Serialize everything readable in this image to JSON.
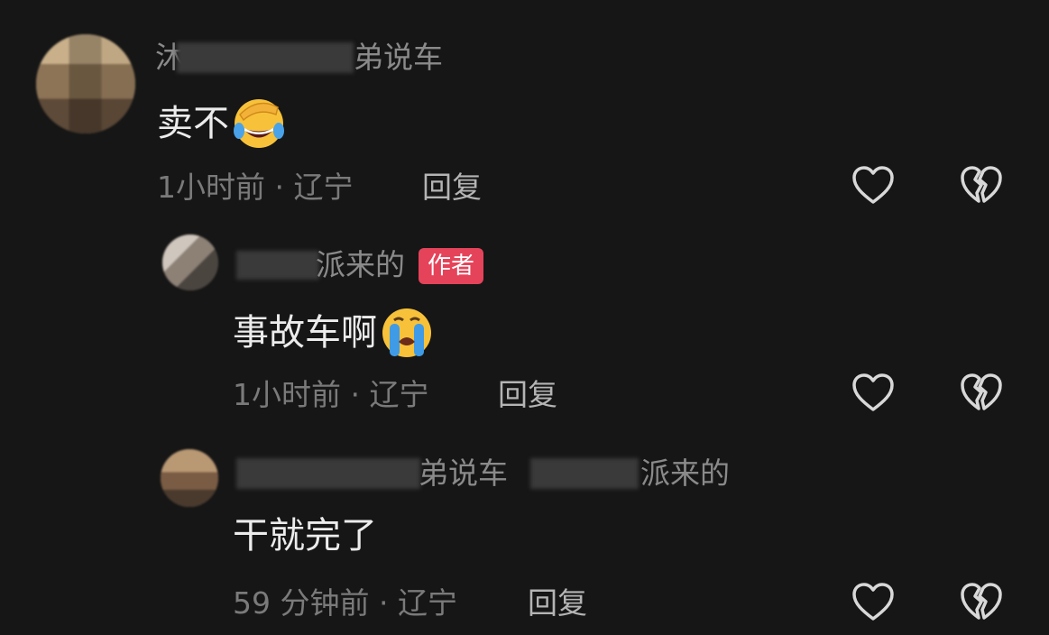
{
  "comments": [
    {
      "author_visible": "沐",
      "author_suffix": "弟说车",
      "text": "卖不",
      "emoji": "face-palm-laughing-emoji",
      "time": "1小时前",
      "location": "辽宁",
      "reply_label": "回复"
    },
    {
      "author_suffix": "派来的",
      "badge": "作者",
      "text": "事故车啊",
      "emoji": "loudly-crying-emoji",
      "time": "1小时前",
      "location": "辽宁",
      "reply_label": "回复"
    },
    {
      "author_suffix": "弟说车",
      "reply_target_suffix": "派来的",
      "text": "干就完了",
      "time": "59 分钟前",
      "location": "辽宁",
      "reply_label": "回复"
    }
  ],
  "meta_separator": "·",
  "icons": {
    "like": "heart-outline-icon",
    "dislike": "broken-heart-icon"
  },
  "colors": {
    "background": "#161616",
    "author_badge": "#e5435a",
    "primary_text": "#ececec",
    "secondary_text": "#8a8a8a"
  }
}
